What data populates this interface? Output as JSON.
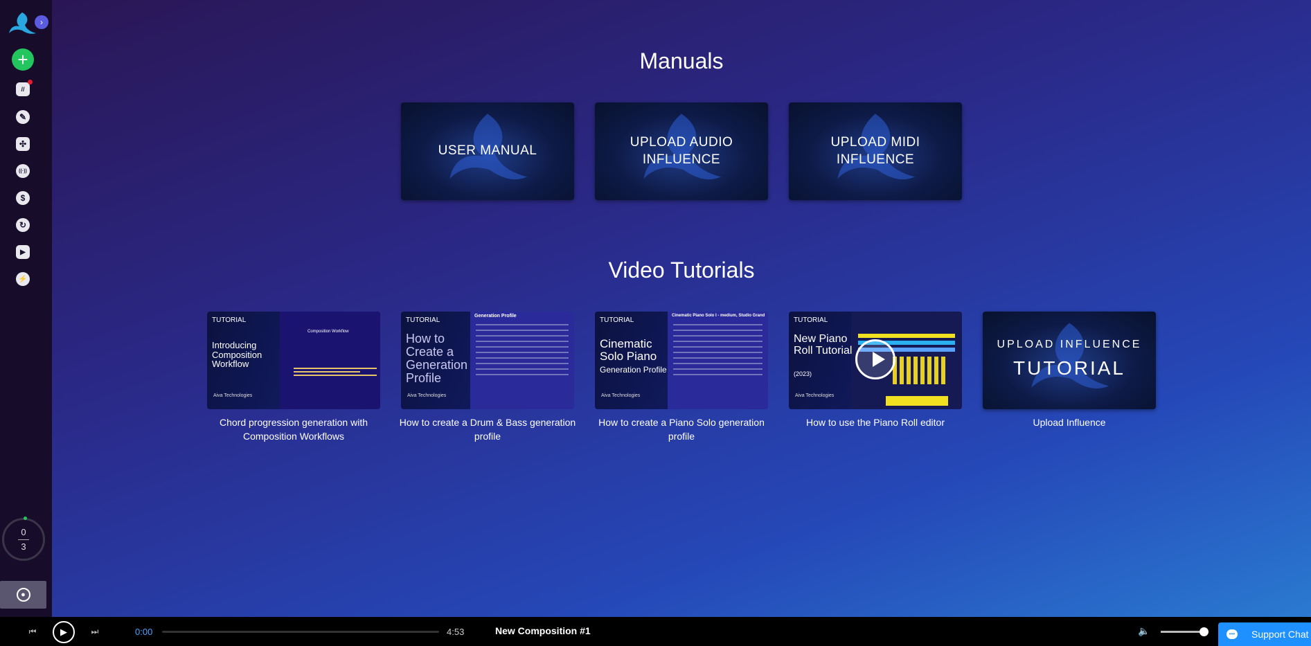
{
  "sidebar": {
    "logo": "aiva-logo-icon",
    "expand": "›",
    "add": "+",
    "items": [
      {
        "name": "sidebar-item-library",
        "glyph": "//"
      },
      {
        "name": "sidebar-item-edit",
        "glyph": "✎"
      },
      {
        "name": "sidebar-item-styles",
        "glyph": "✣"
      },
      {
        "name": "sidebar-item-radio",
        "glyph": "((·))"
      },
      {
        "name": "sidebar-item-pricing",
        "glyph": "$"
      },
      {
        "name": "sidebar-item-history",
        "glyph": "↻"
      },
      {
        "name": "sidebar-item-tutorials",
        "glyph": "▶"
      },
      {
        "name": "sidebar-item-updates",
        "glyph": "⚡"
      }
    ],
    "counter": {
      "top": "0",
      "bottom": "3"
    }
  },
  "manuals": {
    "title": "Manuals",
    "cards": [
      "USER MANUAL",
      "UPLOAD AUDIO INFLUENCE",
      "UPLOAD MIDI INFLUENCE"
    ]
  },
  "tutorials": {
    "title": "Video Tutorials",
    "videos": [
      {
        "tag": "TUTORIAL",
        "thumb_title": "Introducing Composition Workflow",
        "brand": "Aiva Technologies",
        "panel": "Composition Workflow",
        "caption": "Chord progression generation with Composition Workflows"
      },
      {
        "tag": "TUTORIAL",
        "thumb_title": "How to Create a Generation Profile",
        "brand": "Aiva Technologies",
        "panel": "Generation Profile",
        "caption": "How to create a Drum & Bass generation profile"
      },
      {
        "tag": "TUTORIAL",
        "thumb_title": "Cinematic Solo Piano",
        "thumb_sub": "Generation Profile",
        "brand": "Aiva Technologies",
        "panel": "Cinematic Piano Solo I - medium, Studio Grand",
        "caption": "How to create a Piano Solo generation profile"
      },
      {
        "tag": "TUTORIAL",
        "thumb_title": "New Piano Roll Tutorial",
        "thumb_sub": "(2023)",
        "brand": "Aiva Technologies",
        "caption": "How to use the Piano Roll editor"
      },
      {
        "thumb_title": "UPLOAD INFLUENCE",
        "thumb_sub": "TUTORIAL",
        "caption": "Upload Influence"
      }
    ]
  },
  "player": {
    "current_time": "0:00",
    "duration": "4:53",
    "track_title": "New Composition #1",
    "progress": 0,
    "volume": 0.85,
    "support_label": "Support Chat"
  },
  "colors": {
    "accent_green": "#22c55e",
    "accent_blue": "#1e90ff",
    "sidebar_bg": "#170d2a"
  }
}
